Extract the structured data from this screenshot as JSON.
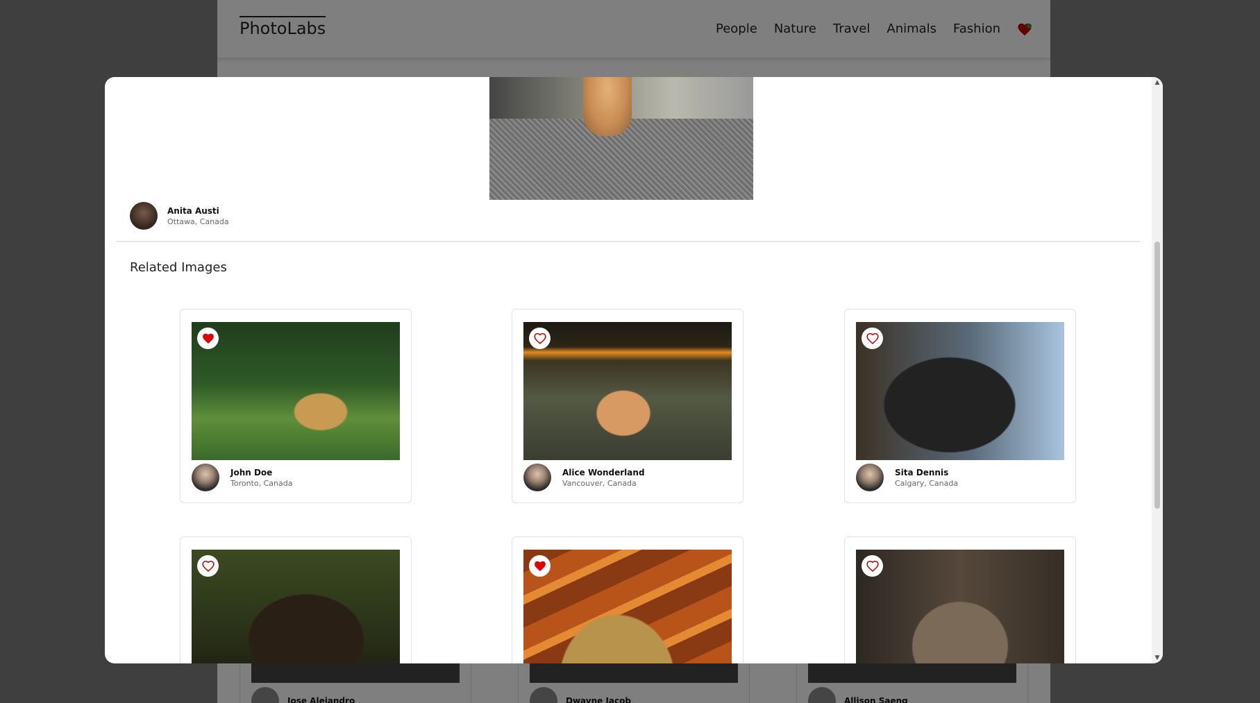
{
  "background": {
    "logo": "PhotoLabs",
    "nav_links": [
      "People",
      "Nature",
      "Travel",
      "Animals",
      "Fashion"
    ],
    "cards": [
      {
        "name": "Jose Alejandro"
      },
      {
        "name": "Dwayne Jacob"
      },
      {
        "name": "Allison Saeng"
      }
    ]
  },
  "modal": {
    "author": {
      "name": "Anita Austi",
      "location": "Ottawa, Canada"
    },
    "related_title": "Related Images",
    "related": [
      {
        "name": "John Doe",
        "location": "Toronto, Canada",
        "favourited": true,
        "image": "jaguar-in-grass"
      },
      {
        "name": "Alice Wonderland",
        "location": "Vancouver, Canada",
        "favourited": false,
        "image": "dog-lying-on-grass"
      },
      {
        "name": "Sita Dennis",
        "location": "Calgary, Canada",
        "favourited": false,
        "image": "black-dog-closeup"
      },
      {
        "name": "",
        "location": "",
        "favourited": false,
        "image": "black-cat-looking-up"
      },
      {
        "name": "",
        "location": "",
        "favourited": true,
        "image": "cat-in-sunlight"
      },
      {
        "name": "",
        "location": "",
        "favourited": false,
        "image": "tabby-cat-closeup"
      }
    ]
  },
  "colors": {
    "heart_red": "#e00000",
    "heart_outline": "#c40000"
  }
}
